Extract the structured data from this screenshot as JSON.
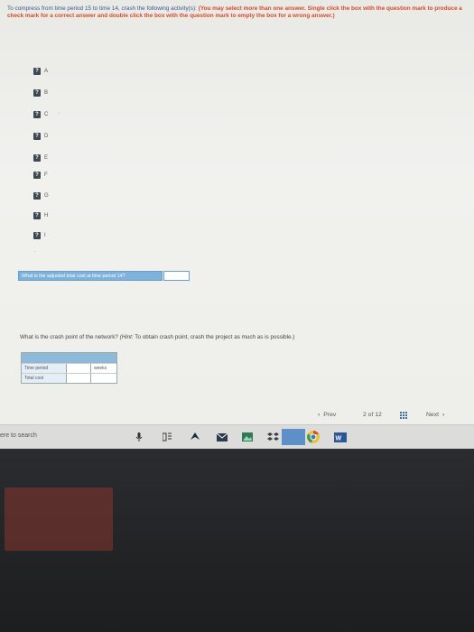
{
  "instructions": {
    "normal": "To compress from time period 15 to time 14, crash the following activity(s):",
    "bold": "(You may select more than one answer. Single click the box with the question mark to produce a check mark for a correct answer and double click the box with the question mark to empty the box for a wrong answer.)"
  },
  "options": [
    {
      "mark": "?",
      "label": "A"
    },
    {
      "mark": "?",
      "label": "B"
    },
    {
      "mark": "?",
      "label": "C"
    },
    {
      "mark": "?",
      "label": "D"
    },
    {
      "mark": "?",
      "label": "E"
    },
    {
      "mark": "?",
      "label": "F"
    },
    {
      "mark": "?",
      "label": "G"
    },
    {
      "mark": "?",
      "label": "H"
    },
    {
      "mark": "?",
      "label": "I"
    }
  ],
  "adjusted_question": "What is the adjusted total cost at time period 14?",
  "adjusted_value": "",
  "crash_question": {
    "text": "What is the crash point of the network?",
    "hint_label": "(Hint:",
    "hint": "To obtain crash point, crash the project as much as is possible.)"
  },
  "crash_table": {
    "rows": [
      {
        "label": "Time period",
        "value": "",
        "unit": "weeks"
      },
      {
        "label": "Total cost",
        "value": "",
        "unit": ""
      }
    ]
  },
  "nav": {
    "prev_arrow": "‹",
    "prev": "Prev",
    "current_page": "2",
    "of": "of",
    "total_pages": "12",
    "next": "Next",
    "next_arrow": "›"
  },
  "taskbar": {
    "search_placeholder": "ere to search"
  },
  "colors": {
    "instruction_blue": "#3a5a90",
    "instruction_red": "#d64a2a",
    "header_blue": "#7fb2da"
  }
}
